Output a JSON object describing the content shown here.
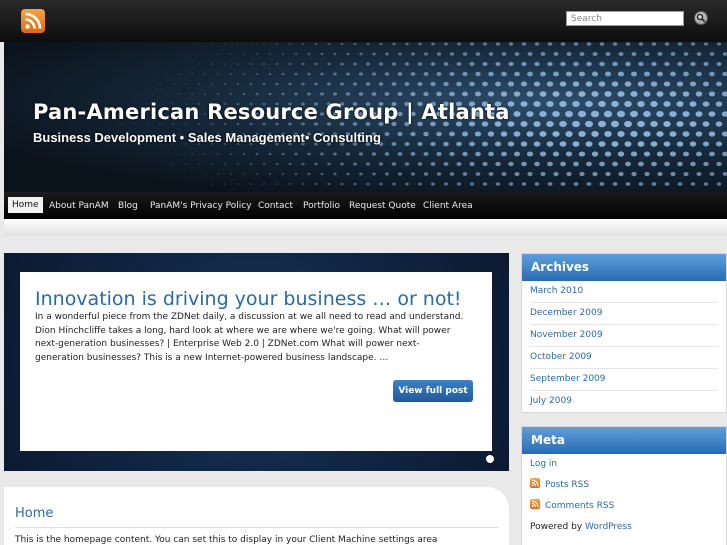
{
  "search": {
    "placeholder": "Search"
  },
  "header": {
    "title": "Pan-American Resource Group | Atlanta",
    "tagline": "Business Development • Sales Management• Consulting"
  },
  "nav": {
    "items": [
      {
        "label": "Home",
        "active": true
      },
      {
        "label": "About PanAM"
      },
      {
        "label": "Blog"
      },
      {
        "label": "PanAM's Privacy Policy"
      },
      {
        "label": "Contact"
      },
      {
        "label": "Portfolio"
      },
      {
        "label": "Request Quote"
      },
      {
        "label": "Client Area"
      }
    ]
  },
  "feature": {
    "title": "Innovation is driving your business … or not!",
    "excerpt": "In a wonderful piece from the ZDNet daily, a discussion at we all need to read and understand. Dion Hinchcliffe takes a long, hard look at where we are where we're going. What will power next-generation businesses? | Enterprise Web 2.0 | ZDNet.com What will power next-generation businesses? This is a new Internet-powered business landscape. …",
    "button_label": "View full post"
  },
  "content": {
    "title": "Home",
    "text": "This is the homepage content. You can set this to display in your Client Machine settings area"
  },
  "sidebar": {
    "archives": {
      "title": "Archives",
      "items": [
        "March 2010",
        "December 2009",
        "November 2009",
        "October 2009",
        "September 2009",
        "July 2009"
      ]
    },
    "meta": {
      "title": "Meta",
      "login": "Log in",
      "posts_rss": "Posts RSS",
      "comments_rss": "Comments RSS",
      "powered_prefix": "Powered by ",
      "powered_link": "WordPress"
    }
  },
  "colors": {
    "accent": "#2b6aa6",
    "rss": "#e8761c",
    "feature_bg": "#0f2340"
  }
}
